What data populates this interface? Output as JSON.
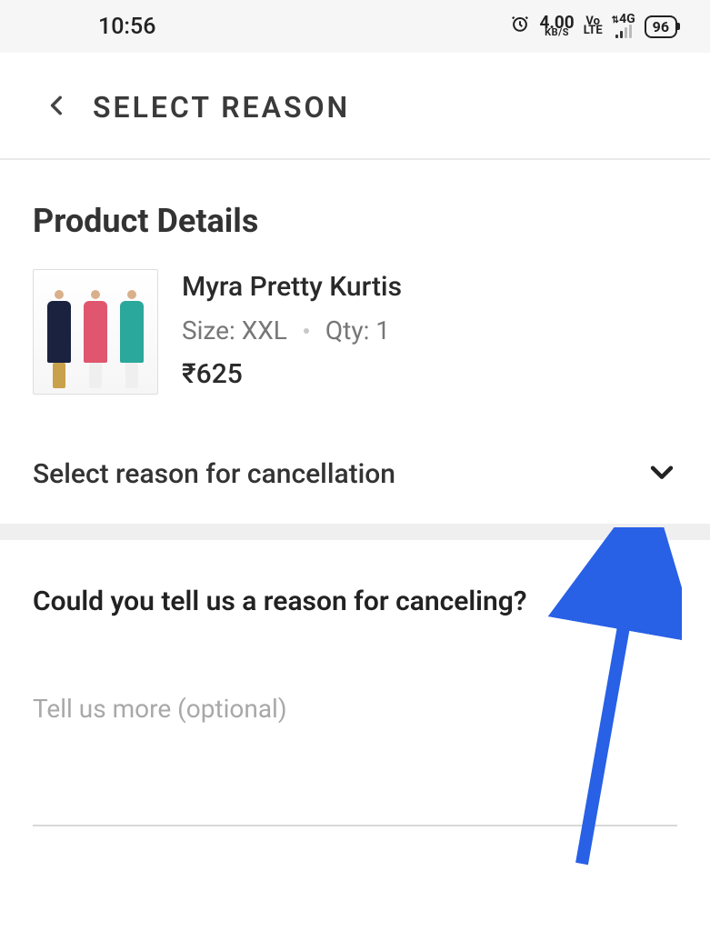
{
  "status_bar": {
    "time": "10:56",
    "data_rate_value": "4.00",
    "data_rate_unit": "KB/S",
    "volte_top": "Vo",
    "volte_bot": "LTE",
    "network_label": "4G",
    "battery": "96"
  },
  "header": {
    "title": "SELECT REASON"
  },
  "product_details": {
    "section_title": "Product Details",
    "name": "Myra Pretty Kurtis",
    "size_label": "Size:",
    "size_value": "XXL",
    "qty_label": "Qty:",
    "qty_value": "1",
    "price": "₹625"
  },
  "reason_dropdown": {
    "label": "Select reason for cancellation"
  },
  "question": {
    "text": "Could you tell us a reason for canceling?"
  },
  "textarea": {
    "placeholder": "Tell us more (optional)"
  }
}
